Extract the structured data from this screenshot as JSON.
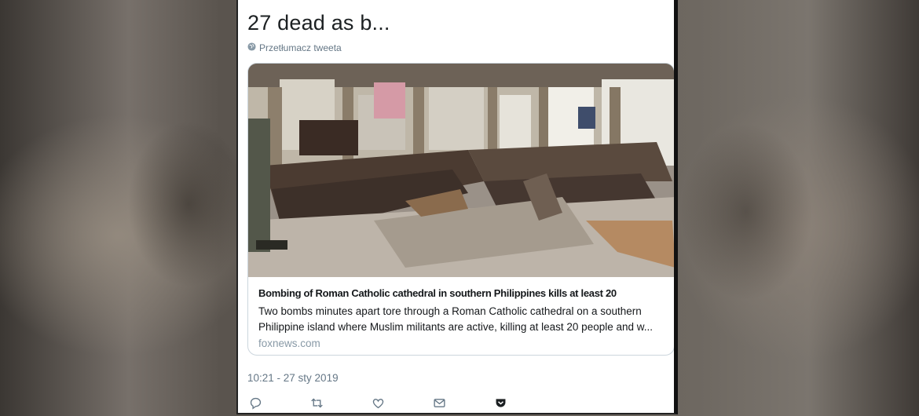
{
  "tweet": {
    "text": "27 dead as b...",
    "translate_label": "Przetłumacz tweeta",
    "timestamp": "10:21 - 27 sty 2019"
  },
  "card": {
    "title": "Bombing of Roman Catholic cathedral in southern Philippines kills at least 20",
    "description": "Two bombs minutes apart tore through a Roman Catholic cathedral on a southern Philippine island where Muslim militants are active, killing at least 20 people and w...",
    "domain": "foxnews.com"
  },
  "actions": [
    {
      "icon": "reply-icon"
    },
    {
      "icon": "retweet-icon"
    },
    {
      "icon": "like-icon"
    },
    {
      "icon": "message-icon"
    },
    {
      "icon": "pocket-icon"
    }
  ],
  "colors": {
    "text_primary": "#1c2022",
    "text_secondary": "#657786",
    "border": "#ccd6dd",
    "pocket": "#1c2022"
  }
}
